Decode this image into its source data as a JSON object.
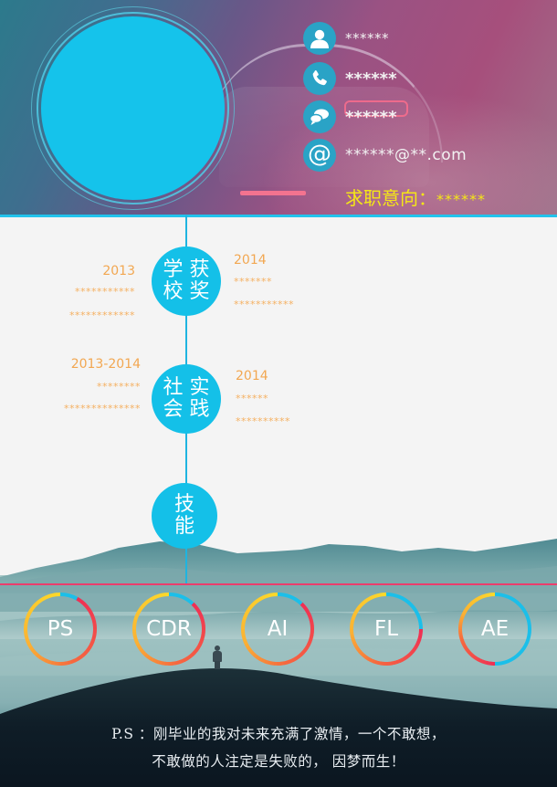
{
  "profile": {
    "avatar_color": "#15c3eb",
    "contacts": [
      {
        "icon": "user-icon",
        "value": "******"
      },
      {
        "icon": "phone-icon",
        "value": "******"
      },
      {
        "icon": "chat-icon",
        "value": "******"
      },
      {
        "icon": "at-icon",
        "value": "******@**.com"
      }
    ],
    "job_intent_label": "求职意向：",
    "job_intent_value": "******"
  },
  "timeline": {
    "school_awards": {
      "title_chars": [
        "学",
        "获",
        "校",
        "奖"
      ],
      "left": {
        "year": "2013",
        "lines": [
          "***********",
          "************"
        ]
      },
      "right": {
        "year": "2014",
        "lines": [
          "*******",
          "***********"
        ]
      }
    },
    "social_practice": {
      "title_chars": [
        "社",
        "实",
        "会",
        "践"
      ],
      "left": {
        "year": "2013-2014",
        "lines": [
          "********",
          "**************"
        ]
      },
      "right": {
        "year": "2014",
        "lines": [
          "******",
          "**********"
        ]
      }
    },
    "skills_node": {
      "title_chars": [
        "技",
        "能"
      ]
    }
  },
  "skills": [
    {
      "name": "PS",
      "level_percent": 92
    },
    {
      "name": "CDR",
      "level_percent": 88
    },
    {
      "name": "AI",
      "level_percent": 88
    },
    {
      "name": "FL",
      "level_percent": 75
    },
    {
      "name": "AE",
      "level_percent": 50
    }
  ],
  "footer": {
    "line1": "P.S ：刚毕业的我对未来充满了激情，一个不敢想，",
    "line2": "不敢做的人注定是失败的， 因梦而生！"
  },
  "colors": {
    "accent_cyan": "#14c0e8",
    "year_orange": "#f2a751",
    "job_intent_yellow": "#f5e617",
    "divider_pink": "#ec3d6c"
  }
}
